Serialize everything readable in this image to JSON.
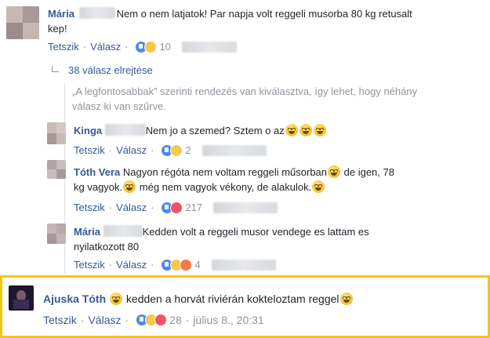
{
  "comments": [
    {
      "author": "Mária",
      "text_a": "Nem o nem latjatok! Par napja volt reggeli musorba 80 kg retusalt",
      "text_b": "kep!",
      "like": "Tetszik",
      "reply": "Válasz",
      "count": "10"
    }
  ],
  "hidden_replies": "38 válasz elrejtése",
  "sort_info_a": "„A legfontosabbak” szerinti rendezés van kiválasztva, így lehet, hogy néhány",
  "sort_info_b": "válasz ki van szűrve.",
  "replies": [
    {
      "author": "Kinga",
      "text": "Nem jo a szemed? Sztem o az",
      "like": "Tetszik",
      "reply": "Válasz",
      "count": "2"
    },
    {
      "author": "Tóth Vera",
      "text_a": "Nagyon régóta nem voltam reggeli műsorban",
      "text_b": "de igen, 78",
      "text_c": "kg vagyok.",
      "text_d": "még nem vagyok vékony, de alakulok.",
      "like": "Tetszik",
      "reply": "Válasz",
      "count": "217"
    },
    {
      "author": "Mária",
      "text_a": "Kedden volt a reggeli musor vendege es lattam es",
      "text_b": "nyilatkozott 80",
      "like": "Tetszik",
      "reply": "Válasz",
      "count": "4"
    }
  ],
  "highlighted": {
    "author": "Ajuska Tóth",
    "text": "kedden a horvát riviérán kokteloztam reggel",
    "like": "Tetszik",
    "reply": "Válasz",
    "count": "28",
    "date": "július 8., 20:31"
  },
  "colors": {
    "name": "#365899",
    "highlight_border": "#f2c814",
    "meta": "#90949c"
  }
}
